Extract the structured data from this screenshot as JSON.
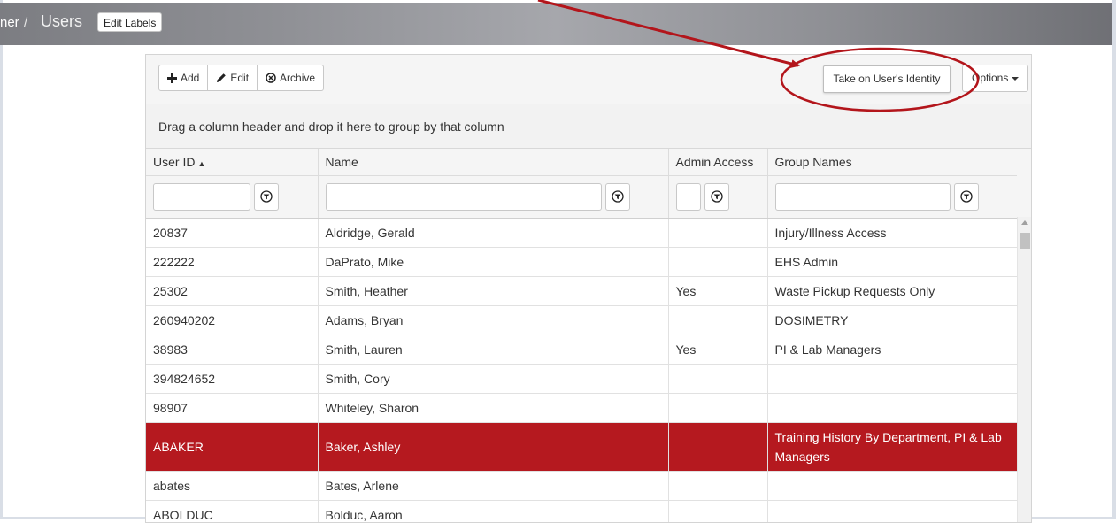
{
  "breadcrumb": {
    "parent": "ner",
    "separator": "/",
    "current": "Users"
  },
  "header": {
    "edit_labels": "Edit Labels"
  },
  "toolbar": {
    "add": "Add",
    "edit": "Edit",
    "archive": "Archive",
    "take_identity": "Take on User's Identity",
    "options": "Options"
  },
  "group_hint": "Drag a column header and drop it here to group by that column",
  "columns": [
    "User ID",
    "Name",
    "Admin Access",
    "Group Names"
  ],
  "rows": [
    {
      "id": "20837",
      "name": "Aldridge, Gerald",
      "admin": "",
      "groups": "Injury/Illness Access"
    },
    {
      "id": "222222",
      "name": "DaPrato, Mike",
      "admin": "",
      "groups": "EHS Admin"
    },
    {
      "id": "25302",
      "name": "Smith, Heather",
      "admin": "Yes",
      "groups": "Waste Pickup Requests Only"
    },
    {
      "id": "260940202",
      "name": "Adams, Bryan",
      "admin": "",
      "groups": "DOSIMETRY"
    },
    {
      "id": "38983",
      "name": "Smith, Lauren",
      "admin": "Yes",
      "groups": "PI & Lab Managers"
    },
    {
      "id": "394824652",
      "name": "Smith, Cory",
      "admin": "",
      "groups": ""
    },
    {
      "id": "98907",
      "name": "Whiteley, Sharon",
      "admin": "",
      "groups": ""
    },
    {
      "id": "ABAKER",
      "name": "Baker, Ashley",
      "admin": "",
      "groups": "Training History By Department, PI & Lab Managers"
    },
    {
      "id": "abates",
      "name": "Bates, Arlene",
      "admin": "",
      "groups": ""
    },
    {
      "id": "ABOLDUC",
      "name": "Bolduc, Aaron",
      "admin": "",
      "groups": ""
    }
  ],
  "selected_row_id": "ABAKER",
  "colors": {
    "selected_row": "#b5191f",
    "annotation": "#b3151b"
  },
  "icons": {
    "add": "plus-icon",
    "edit": "pencil-icon",
    "archive": "circle-x-icon",
    "filter": "filter-icon",
    "sort": "sort-asc-icon"
  }
}
